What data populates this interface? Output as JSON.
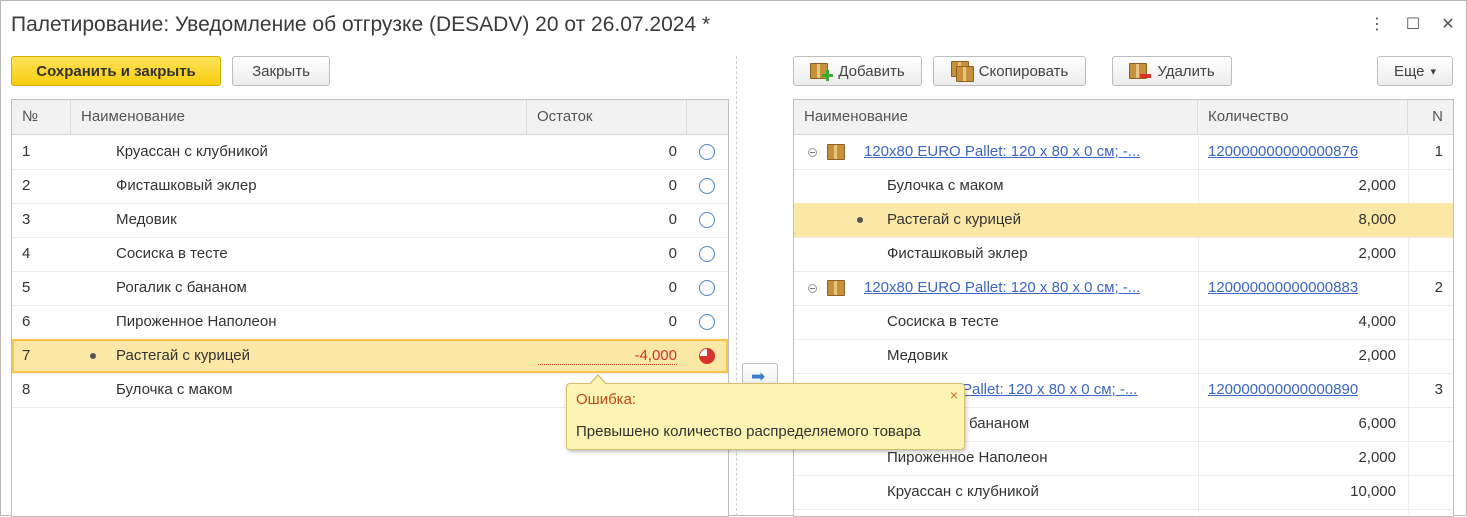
{
  "window": {
    "title": "Палетирование: Уведомление об отгрузке (DESADV) 20 от 26.07.2024 *",
    "more_icon": "⋮",
    "maximize_icon": "☐",
    "close_icon": "✕"
  },
  "toolbar_left": {
    "save_close": "Сохранить и закрыть",
    "close": "Закрыть"
  },
  "toolbar_right": {
    "add": "Добавить",
    "copy": "Скопировать",
    "delete": "Удалить",
    "more": "Еще",
    "more_arrow": "▾"
  },
  "left_table": {
    "headers": {
      "num": "№",
      "name": "Наименование",
      "rest": "Остаток"
    },
    "rows": [
      {
        "num": "1",
        "name": "Круассан с клубникой",
        "rest": "0"
      },
      {
        "num": "2",
        "name": "Фисташковый эклер",
        "rest": "0"
      },
      {
        "num": "3",
        "name": "Медовик",
        "rest": "0"
      },
      {
        "num": "4",
        "name": "Сосиска в тесте",
        "rest": "0"
      },
      {
        "num": "5",
        "name": "Рогалик с бананом",
        "rest": "0"
      },
      {
        "num": "6",
        "name": "Пироженное Наполеон",
        "rest": "0"
      },
      {
        "num": "7",
        "name": "Растегай с курицей",
        "rest": "-4,000"
      },
      {
        "num": "8",
        "name": "Булочка с маком",
        "rest": ""
      }
    ]
  },
  "move_button_icon": "➡",
  "right_table": {
    "headers": {
      "name": "Наименование",
      "qty": "Количество",
      "n": "N"
    },
    "pallets": [
      {
        "name": "120x80 EURO Pallet:   120 x 80 x 0 см;   -...",
        "code": "120000000000000876",
        "n": "1",
        "items": [
          {
            "name": "Булочка с маком",
            "qty": "2,000"
          },
          {
            "name": "Растегай с курицей",
            "qty": "8,000"
          },
          {
            "name": "Фисташковый эклер",
            "qty": "2,000"
          }
        ]
      },
      {
        "name": "120x80 EURO Pallet:   120 x 80 x 0 см;   -...",
        "code": "120000000000000883",
        "n": "2",
        "items": [
          {
            "name": "Сосиска в тесте",
            "qty": "4,000"
          },
          {
            "name": "Медовик",
            "qty": "2,000"
          }
        ]
      },
      {
        "name": "Pallet:   120 x 80 x 0 см;   -...",
        "code": "120000000000000890",
        "n": "3",
        "items": [
          {
            "name": "бананом",
            "qty": "6,000"
          },
          {
            "name": "Пироженное Наполеон",
            "qty": "2,000"
          },
          {
            "name": "Круассан с клубникой",
            "qty": "10,000"
          }
        ]
      }
    ]
  },
  "error_tooltip": {
    "title": "Ошибка:",
    "message": "Превышено количество распределяемого товара",
    "close_icon": "×"
  },
  "colors": {
    "primary_button": "#f7cd0c",
    "selected_row": "#fbe8a6",
    "link": "#3c66c0",
    "negative": "#d8342b",
    "tooltip_bg": "#fdf3b2"
  }
}
